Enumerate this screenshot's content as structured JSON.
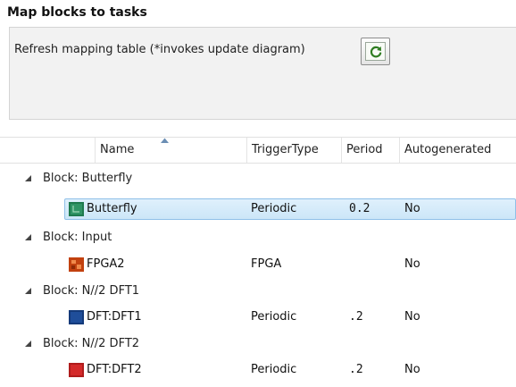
{
  "panel": {
    "title": "Map blocks to tasks",
    "refresh_label": "Refresh mapping table (*invokes update diagram)"
  },
  "table": {
    "columns": [
      "Name",
      "TriggerType",
      "Period",
      "Autogenerated"
    ],
    "sorted_column": "Name",
    "groups": [
      {
        "label": "Block: Butterfly",
        "expanded": true,
        "row": {
          "name": "Butterfly",
          "trigger": "Periodic",
          "period": "0.2",
          "auto": "No",
          "icon_color": "#1e7a4e",
          "selected": true
        }
      },
      {
        "label": "Block: Input",
        "expanded": true,
        "row": {
          "name": "FPGA2",
          "trigger": "FPGA",
          "period": "",
          "auto": "No",
          "icon_color": "#d9531e",
          "selected": false
        }
      },
      {
        "label": "Block: N//2 DFT1",
        "expanded": true,
        "row": {
          "name": "DFT:DFT1",
          "trigger": "Periodic",
          "period": ".2",
          "auto": "No",
          "icon_color": "#1f4e9a",
          "selected": false
        }
      },
      {
        "label": "Block: N//2 DFT2",
        "expanded": true,
        "row": {
          "name": "DFT:DFT2",
          "trigger": "Periodic",
          "period": ".2",
          "auto": "No",
          "icon_color": "#d42a2a",
          "selected": false
        }
      }
    ]
  }
}
